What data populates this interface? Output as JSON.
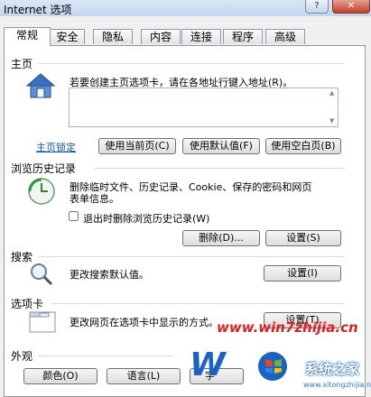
{
  "window": {
    "title": "Internet 选项",
    "help_glyph": "?",
    "close_glyph": "✕"
  },
  "tabs": [
    "常规",
    "安全",
    "隐私",
    "内容",
    "连接",
    "程序",
    "高级"
  ],
  "homepage": {
    "section_title": "主页",
    "description": "若要创建主页选项卡，请在各地址行键入地址(R)。",
    "address_value": "",
    "lock_link": "主页锁定",
    "use_current": "使用当前页(C)",
    "use_default": "使用默认值(F)",
    "use_blank": "使用空白页(B)"
  },
  "history": {
    "section_title": "浏览历史记录",
    "description_line1": "删除临时文件、历史记录、Cookie、保存的密码和网页",
    "description_line2": "表单信息。",
    "delete_on_exit_label": "退出时删除浏览历史记录(W)",
    "delete_on_exit_checked": false,
    "delete_button": "删除(D)...",
    "settings_button": "设置(S)"
  },
  "search": {
    "section_title": "搜索",
    "description": "更改搜索默认值。",
    "settings_button": "设置(I)"
  },
  "tabs_section": {
    "section_title": "选项卡",
    "description": "更改网页在选项卡中显示的方式。",
    "settings_button": "设置(T)"
  },
  "appearance": {
    "section_title": "外观",
    "colors_button": "颜色(O)",
    "languages_button": "语言(L)",
    "fonts_button": "字"
  },
  "watermark": {
    "url": "www.win7zhijia.cn",
    "brand": "系统之家",
    "small": "www.xitongzhijia.net"
  }
}
